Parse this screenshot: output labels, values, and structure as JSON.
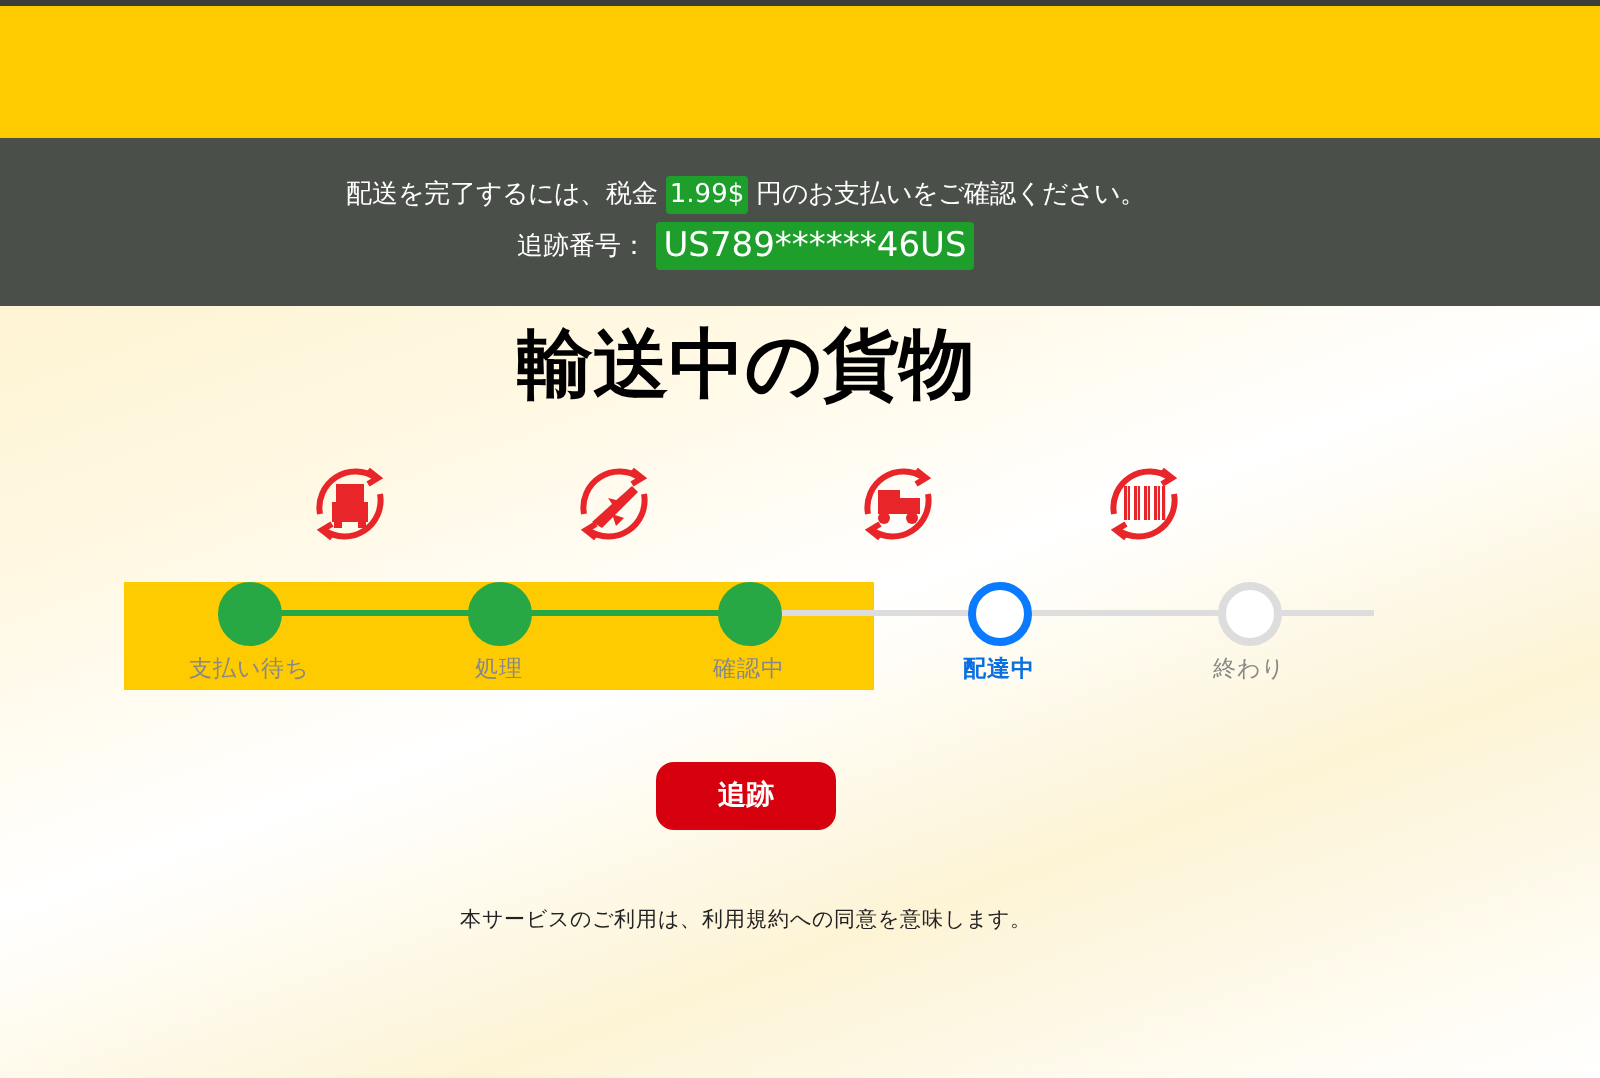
{
  "notice": {
    "before": "配送を完了するには、税金",
    "amount": "1.99$",
    "after": "円のお支払いをご確認ください。",
    "tracking_label": "追跡番号：",
    "tracking_number": "US789******46US"
  },
  "title": "輸送中の貨物",
  "steps": [
    {
      "label": "支払い待ち",
      "completed": true,
      "selected": false
    },
    {
      "label": "処理",
      "completed": true,
      "selected": false
    },
    {
      "label": "確認中",
      "completed": true,
      "selected": false
    },
    {
      "label": "配達中",
      "completed": false,
      "selected": true
    },
    {
      "label": "終わり",
      "completed": false,
      "selected": false
    }
  ],
  "track_button": "追跡",
  "footer": "本サービスのご利用は、利用規約への同意を意味します。"
}
